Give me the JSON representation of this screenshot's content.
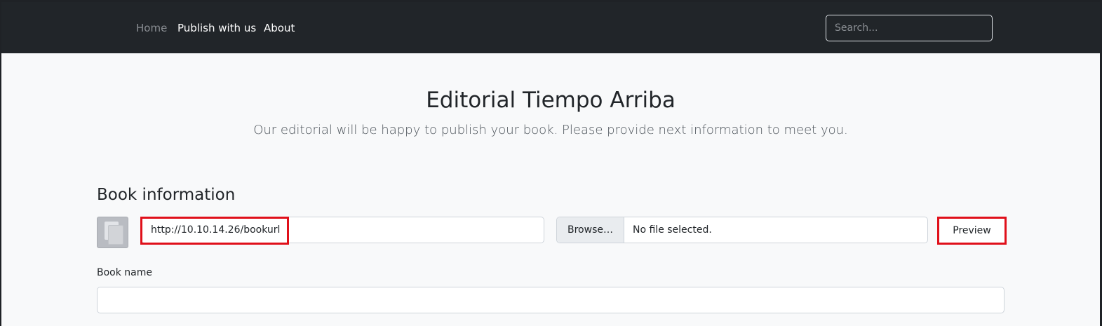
{
  "nav": {
    "home": "Home",
    "publish": "Publish with us",
    "about": "About",
    "search_placeholder": "Search..."
  },
  "header": {
    "title": "Editorial Tiempo Arriba",
    "subtitle": "Our editorial will be happy to publish your book. Please provide next information to meet you."
  },
  "book_info": {
    "section_title": "Book information",
    "cover_url": "http://10.10.14.26/bookurl",
    "browse_label": "Browse…",
    "file_status": "No file selected.",
    "preview_label": "Preview",
    "book_name_label": "Book name",
    "book_name_value": ""
  },
  "colors": {
    "navbar_bg": "#212529",
    "page_bg": "#f8f9fa",
    "highlight": "#e0101a"
  },
  "icons": {
    "cover": "book-cover-placeholder-icon"
  }
}
